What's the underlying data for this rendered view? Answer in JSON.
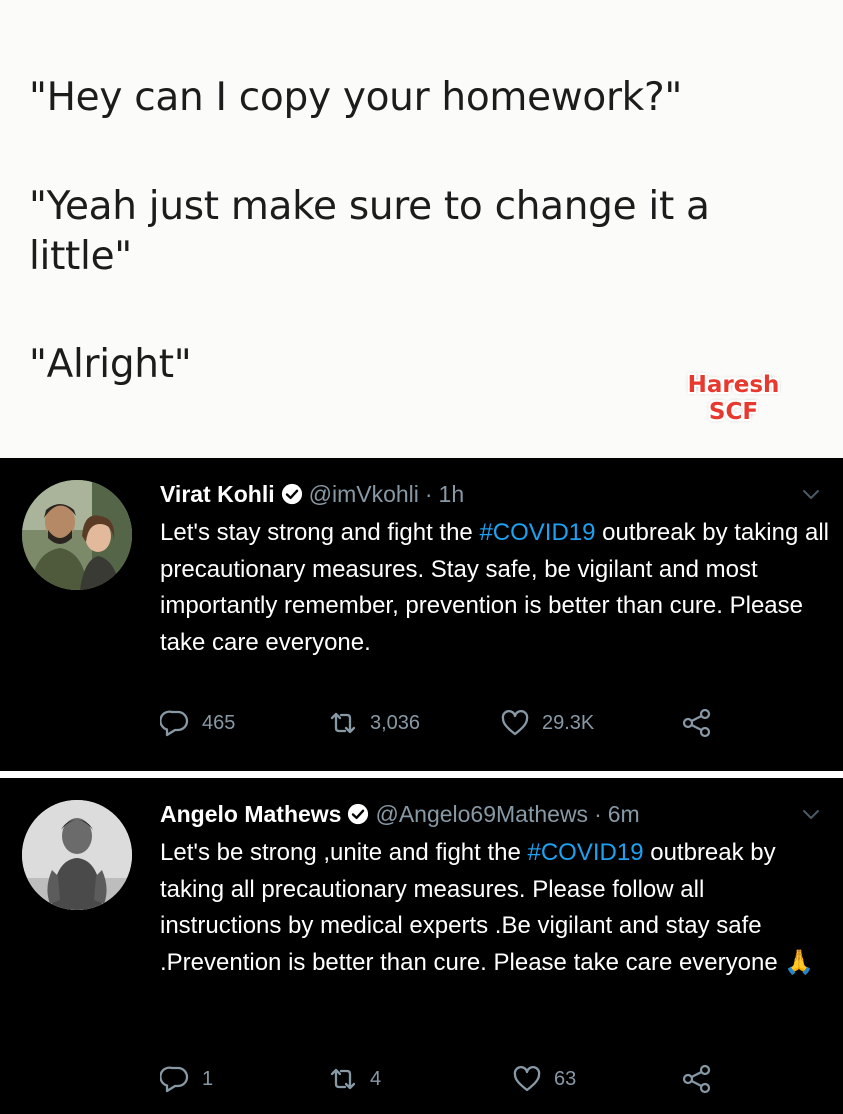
{
  "meme": {
    "line1": "\"Hey can I copy your homework?\"",
    "line2": "\"Yeah just make sure to change it a",
    "line3": "little\"",
    "line4": "\"Alright\"",
    "watermark_line1": "Haresh",
    "watermark_line2": "SCF"
  },
  "tweets": [
    {
      "name": "Virat Kohli",
      "handle": "@imVkohli",
      "dot": "·",
      "time": "1h",
      "text_before": "Let's stay strong and fight the ",
      "hashtag": "#COVID19",
      "text_after": " outbreak by taking all precautionary measures. Stay safe, be vigilant and most importantly remember, prevention is better than cure. Please take care everyone.",
      "replies": "465",
      "retweets": "3,036",
      "likes": "29.3K"
    },
    {
      "name": "Angelo Mathews",
      "handle": "@Angelo69Mathews",
      "dot": "·",
      "time": "6m",
      "text_before": "Let's be strong ,unite and fight the ",
      "hashtag": "#COVID19",
      "text_after": " outbreak by taking all precautionary measures. Please follow all instructions by medical experts .Be vigilant and stay safe .Prevention is better than cure. Please take care everyone",
      "emoji": "🙏",
      "replies": "1",
      "retweets": "4",
      "likes": "63"
    }
  ],
  "colors": {
    "background": "#000000",
    "link": "#1da1f2",
    "secondary_text": "#8899a6",
    "watermark": "#e8392e"
  }
}
